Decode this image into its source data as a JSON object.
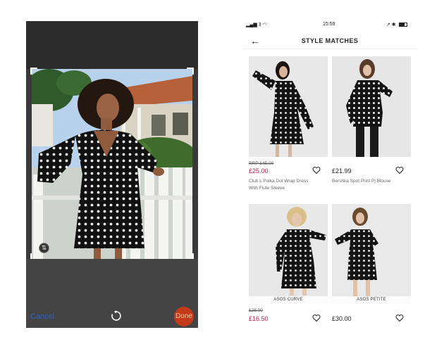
{
  "editor": {
    "cancel_label": "Cancel",
    "done_label": "Done",
    "rotate_icon": "rotate-icon",
    "aspect_icon": "aspect-ratio-icon"
  },
  "status_bar": {
    "signal": "▂▄▆ 3 ◠",
    "time": "15:59",
    "right": "↗ ✱"
  },
  "header": {
    "back_icon": "←",
    "title": "STYLE MATCHES"
  },
  "products": [
    {
      "rrp": "RRP £45.00",
      "price": "£25.00",
      "name": "Club L Polka Dot Wrap Dress With Flute Sleeve",
      "badge": ""
    },
    {
      "rrp": "",
      "price": "£21.99",
      "name": "Bershka Spot Print Pj Blouse",
      "badge": ""
    },
    {
      "rrp": "£28.00",
      "price": "£16.50",
      "name": "",
      "badge": "ASOS CURVE"
    },
    {
      "rrp": "",
      "price": "£30.00",
      "name": "",
      "badge": "ASOS PETITE"
    }
  ],
  "colors": {
    "sale_price": "#b0214f",
    "cancel": "#2a62c9",
    "done_button": "#c23a18"
  }
}
